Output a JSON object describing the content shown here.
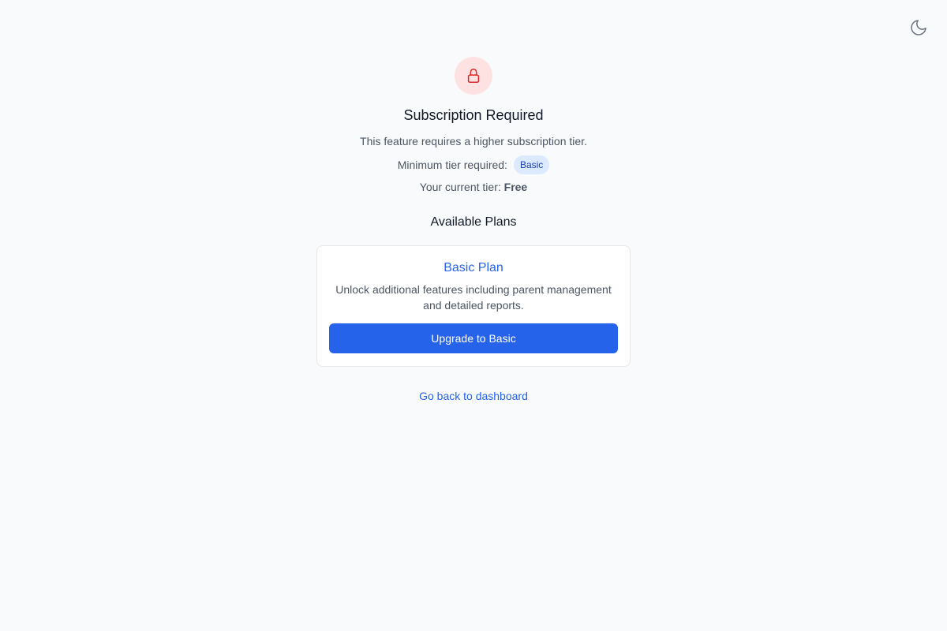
{
  "header": {
    "theme_toggle_icon": "moon-icon"
  },
  "notice": {
    "icon": "lock-icon",
    "icon_color": "#dc2626",
    "icon_bg": "#fee2e2",
    "title": "Subscription Required",
    "description": "This feature requires a higher subscription tier.",
    "min_tier_label": "Minimum tier required:",
    "min_tier_badge": "Basic",
    "current_tier_label": "Your current tier:",
    "current_tier_value": "Free"
  },
  "plans": {
    "heading": "Available Plans",
    "items": [
      {
        "name": "Basic Plan",
        "description": "Unlock additional features including parent management and detailed reports.",
        "button_label": "Upgrade to Basic"
      }
    ]
  },
  "footer": {
    "back_link": "Go back to dashboard"
  },
  "colors": {
    "accent": "#2563eb",
    "background": "#f9fafb",
    "badge_bg": "#dbeafe",
    "badge_text": "#1e40af"
  }
}
